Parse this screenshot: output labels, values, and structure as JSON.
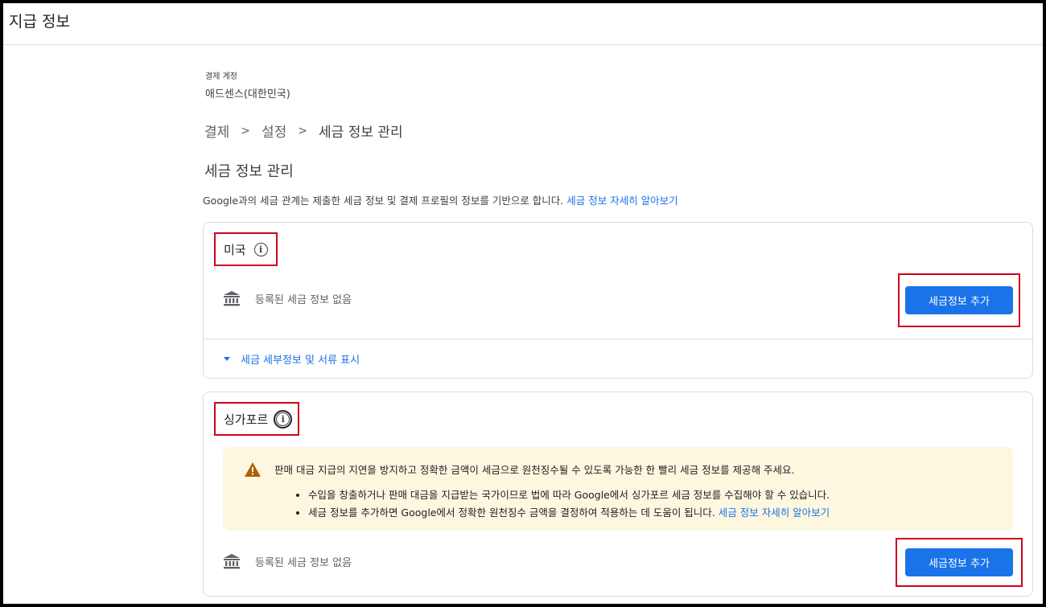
{
  "header": {
    "title": "지급 정보"
  },
  "account": {
    "label": "결제 계정",
    "name": "애드센스(대한민국)"
  },
  "breadcrumb": [
    "결제",
    "설정",
    "세금 정보 관리"
  ],
  "page": {
    "title": "세금 정보 관리",
    "description": "Google과의 세금 관계는 제출한 세금 정보 및 결제 프로필의 정보를 기반으로 합니다.",
    "learn_more": "세금 정보 자세히 알아보기"
  },
  "cards": {
    "us": {
      "country": "미국",
      "status": "등록된 세금 정보 없음",
      "button": "세금정보 추가",
      "expander": "세금 세부정보 및 서류 표시"
    },
    "sg": {
      "country": "싱가포르",
      "warning": "판매 대금 지급의 지연을 방지하고 정확한 금액이 세금으로 원천징수될 수 있도록 가능한 한 빨리 세금 정보를 제공해 주세요.",
      "bullets": [
        "수입을 창출하거나 판매 대금을 지급받는 국가이므로 법에 따라 Google에서 싱가포르 세금 정보를 수집해야 할 수 있습니다.",
        "세금 정보를 추가하면 Google에서 정확한 원천징수 금액을 결정하여 적용하는 데 도움이 됩니다."
      ],
      "learn_more": "세금 정보 자세히 알아보기",
      "status": "등록된 세금 정보 없음",
      "button": "세금정보 추가"
    }
  },
  "colors": {
    "accent": "#1a73e8",
    "highlight": "#d0021b",
    "warning_bg": "#fef7e0",
    "warning_icon": "#b06000"
  },
  "icons": {
    "info": "info-icon",
    "bank": "bank-icon",
    "warning": "warning-icon",
    "caret": "caret-down-icon"
  }
}
